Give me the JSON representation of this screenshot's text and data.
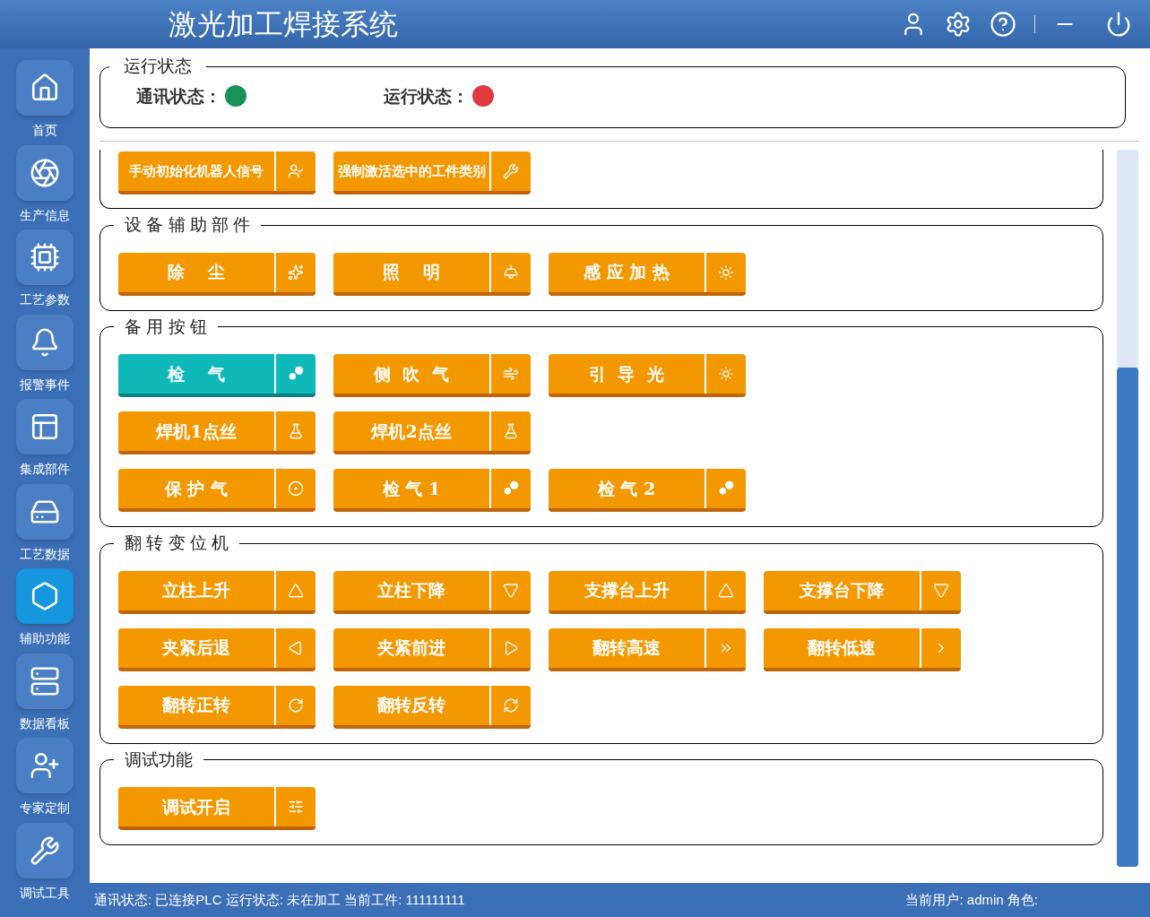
{
  "header": {
    "title": "激光加工焊接系统"
  },
  "sidebar": {
    "items": [
      {
        "label": "首页",
        "selected": false
      },
      {
        "label": "生产信息",
        "selected": false
      },
      {
        "label": "工艺参数",
        "selected": false
      },
      {
        "label": "报警事件",
        "selected": false
      },
      {
        "label": "集成部件",
        "selected": false
      },
      {
        "label": "工艺数据",
        "selected": false
      },
      {
        "label": "辅助功能",
        "selected": true
      },
      {
        "label": "数据看板",
        "selected": false
      },
      {
        "label": "专家定制",
        "selected": false
      },
      {
        "label": "调试工具",
        "selected": false
      }
    ]
  },
  "run_status": {
    "title": "运行状态",
    "indicators": [
      {
        "label": "通讯状态：",
        "color": "#17935a"
      },
      {
        "label": "运行状态：",
        "color": "#e0393e"
      }
    ]
  },
  "groups": [
    {
      "rows": [
        [
          {
            "label": "手动初始化机器人信号",
            "on": false
          },
          {
            "label": "强制激活选中的工件类别",
            "on": false
          }
        ]
      ]
    },
    {
      "title": "设 备 辅 助 部 件",
      "rows": [
        [
          {
            "label": "除    尘",
            "on": false
          },
          {
            "label": "照    明",
            "on": false
          },
          {
            "label": "感 应 加 热",
            "on": false
          }
        ]
      ]
    },
    {
      "title": "备 用 按 钮",
      "rows": [
        [
          {
            "label": "检    气",
            "on": true
          },
          {
            "label": "侧  吹  气",
            "on": false
          },
          {
            "label": "引  导  光",
            "on": false
          }
        ],
        [
          {
            "label": "焊机1点丝",
            "on": false
          },
          {
            "label": "焊机2点丝",
            "on": false
          }
        ],
        [
          {
            "label": "保 护 气",
            "on": false
          },
          {
            "label": "检 气 1",
            "on": false
          },
          {
            "label": "检 气 2",
            "on": false
          }
        ]
      ]
    },
    {
      "title": "翻 转 变 位 机",
      "rows": [
        [
          {
            "label": "立柱上升",
            "on": false
          },
          {
            "label": "立柱下降",
            "on": false
          },
          {
            "label": "支撑台上升",
            "on": false
          },
          {
            "label": "支撑台下降",
            "on": false
          }
        ],
        [
          {
            "label": "夹紧后退",
            "on": false
          },
          {
            "label": "夹紧前进",
            "on": false
          },
          {
            "label": "翻转高速",
            "on": false
          },
          {
            "label": "翻转低速",
            "on": false
          }
        ],
        [
          {
            "label": "翻转正转",
            "on": false
          },
          {
            "label": "翻转反转",
            "on": false
          }
        ]
      ]
    },
    {
      "title": "调试功能",
      "rows": [
        [
          {
            "label": "调试开启",
            "on": false
          }
        ]
      ]
    }
  ],
  "status_bar": {
    "left": "通讯状态: 已连接PLC 运行状态: 未在加工 当前工件: 111111111",
    "right": "当前用户: admin 角色:"
  }
}
